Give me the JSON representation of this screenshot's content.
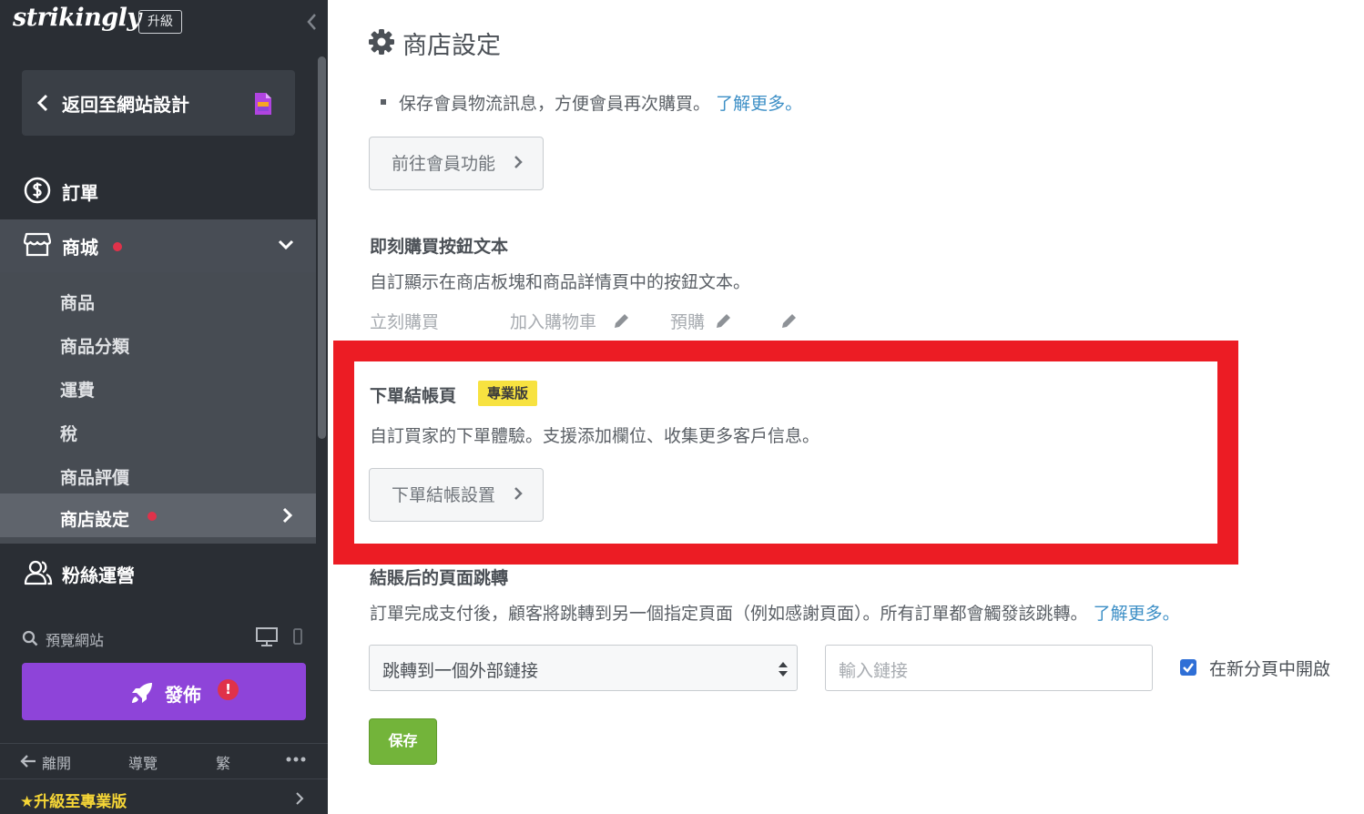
{
  "sidebar": {
    "logo": "strikingly",
    "upgrade_badge": "升級",
    "back_label": "返回至網站設計",
    "nav": {
      "orders": "訂單",
      "store": "商城",
      "fans": "粉絲運營"
    },
    "store_sub": [
      "商品",
      "商品分類",
      "運費",
      "稅",
      "商品評價",
      "商店設定"
    ],
    "preview_label": "預覽網站",
    "publish_label": "發佈",
    "publish_alert": "!",
    "bottom": {
      "leave": "離開",
      "tour": "導覽",
      "lang": "繁"
    },
    "upgrade_pro": "★升級至專業版"
  },
  "main": {
    "title": "商店設定",
    "bullet_text": "保存會員物流訊息，方便會員再次購買。",
    "bullet_link": "了解更多。",
    "member_button": "前往會員功能",
    "buy_heading": "即刻購買按鈕文本",
    "buy_desc": "自訂顯示在商店板塊和商品詳情頁中的按鈕文本。",
    "buy_labels": {
      "buy_now": "立刻購買",
      "add_cart": "加入購物車",
      "preorder": "預購"
    },
    "checkout_heading": "下單結帳頁",
    "pro_badge": "專業版",
    "checkout_desc": "自訂買家的下單體驗。支援添加欄位、收集更多客戶信息。",
    "checkout_button": "下單結帳設置",
    "redirect_heading": "結賬后的頁面跳轉",
    "redirect_desc": "訂單完成支付後，顧客將跳轉到另一個指定頁面（例如感謝頁面）。所有訂單都會觸發該跳轉。",
    "redirect_link": "了解更多。",
    "redirect_select_value": "跳轉到一個外部鏈接",
    "url_placeholder": "輸入鏈接",
    "new_tab_label": "在新分頁中開啟",
    "save_label": "保存"
  },
  "colors": {
    "sidebar_bg": "#2a2e34",
    "publish": "#8e44d9",
    "alert_red": "#e0324a",
    "link_blue": "#3d8fc6",
    "save_green": "#73b43a",
    "pro_badge_yellow": "#f7e240",
    "highlight_red": "#ec1c24"
  }
}
